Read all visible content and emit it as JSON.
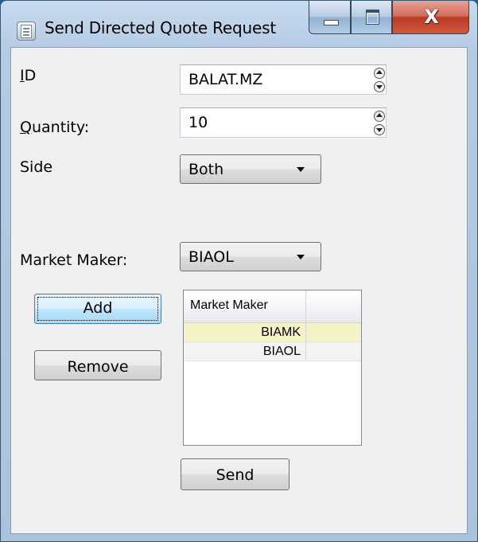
{
  "window": {
    "title": "Send Directed Quote Request",
    "close_glyph": "X"
  },
  "form": {
    "id_label_prefix": "I",
    "id_label_rest": "D",
    "id_value": "BALAT.MZ",
    "quantity_label_prefix": "Q",
    "quantity_label_rest": "uantity:",
    "quantity_value": "10",
    "side_label": "Side",
    "side_value": "Both",
    "market_maker_label": "Market Maker:",
    "market_maker_value": "BIAOL"
  },
  "buttons": {
    "add": "Add",
    "remove": "Remove",
    "send": "Send"
  },
  "grid": {
    "header": "Market Maker",
    "rows": [
      "BIAMK",
      "BIAOL"
    ]
  },
  "colors": {
    "selected_row": "#f5f2c6",
    "close_button": "#c74a30"
  },
  "icons": {
    "app": "quote-request-icon",
    "minimize": "minimize-icon",
    "maximize": "maximize-icon",
    "close": "close-icon"
  }
}
